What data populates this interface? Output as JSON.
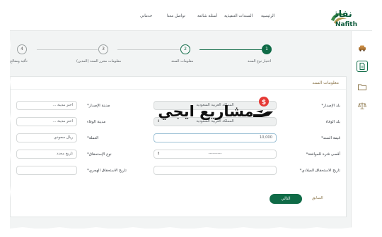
{
  "header": {
    "logo_ar": "نفاذ",
    "logo_en": "Nafith",
    "nav": [
      "الرئيسية",
      "السندات التنفيذية",
      "أسئلة شائعة",
      "تواصل معنا",
      "خدماتي"
    ]
  },
  "stepper": {
    "steps": [
      {
        "number": "1",
        "label": "اختيار نوع السند"
      },
      {
        "number": "2",
        "label": "معلومات السند"
      },
      {
        "number": "3",
        "label": "معلومات محرر السند (المدين)"
      },
      {
        "number": "4",
        "label": "تأكيد ومعالج"
      }
    ]
  },
  "form": {
    "section_title": "معلومات السند",
    "right": {
      "issue_country_label": "بلد الإصدار*",
      "issue_country_value": "المملكة العربية السعودية",
      "payment_country_label": "بلد الوفاء",
      "payment_country_value": "المملكة العربية السعودية",
      "bond_value_label": "قيمة السند*",
      "bond_value_value": "10,000",
      "approval_period_label": "أقصى فترة للموافقة*",
      "approval_period_value": "----------",
      "due_date_gregorian_label": "تاريخ الاستحقاق الميلادي*",
      "due_date_gregorian_value": ""
    },
    "left": {
      "issue_city_label": "مدينة الإصدار*",
      "issue_city_value": "اختر مدينة ...",
      "payment_city_label": "مدينة الوفاء",
      "payment_city_value": "اختر مدينة ...",
      "currency_label": "العملة*",
      "currency_value": "ريال سعودي",
      "due_type_label": "نوع الإستحقاق*",
      "due_type_value": "تاريخ محدد",
      "due_date_hijri_label": "تاريخ الاستحقاق الهجري*",
      "due_date_hijri_value": ""
    },
    "buttons": {
      "next": "التالي",
      "previous": "السابق"
    }
  },
  "watermark": {
    "text": "مشاريع ايجي"
  },
  "icons": {
    "sidebar": [
      "car-icon",
      "document-icon",
      "folder-icon",
      "scales-icon"
    ]
  },
  "colors": {
    "brand_green": "#0f6b47",
    "gold": "#8a7448"
  }
}
